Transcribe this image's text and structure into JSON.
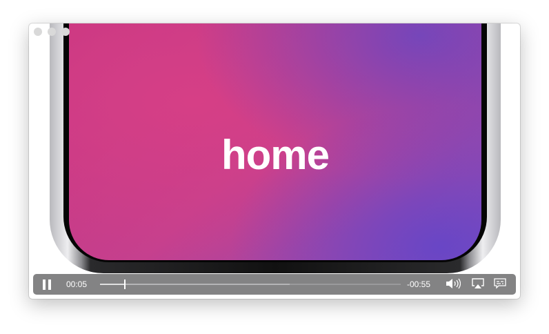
{
  "video": {
    "caption": "home"
  },
  "controls": {
    "current_time": "00:05",
    "remaining_time": "-00:55",
    "progress_percent": 8.3,
    "buffered_percent": 63,
    "state": "playing"
  },
  "icons": [
    "pause-icon",
    "volume-icon",
    "airplay-icon",
    "subtitles-icon"
  ]
}
